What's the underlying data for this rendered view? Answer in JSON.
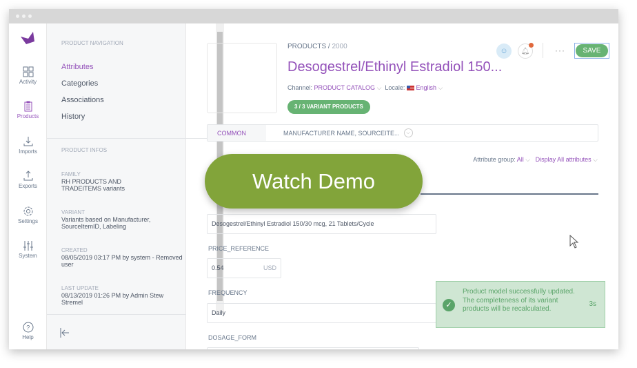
{
  "sidebar": {
    "items": [
      {
        "label": "Activity",
        "icon": "grid-icon"
      },
      {
        "label": "Products",
        "icon": "clipboard-icon",
        "active": true
      },
      {
        "label": "Imports",
        "icon": "import-icon"
      },
      {
        "label": "Exports",
        "icon": "export-icon"
      },
      {
        "label": "Settings",
        "icon": "gear-icon"
      },
      {
        "label": "System",
        "icon": "sliders-icon"
      }
    ],
    "help": "Help"
  },
  "nav": {
    "section_title": "PRODUCT NAVIGATION",
    "links": [
      "Attributes",
      "Categories",
      "Associations",
      "History"
    ],
    "infos_title": "PRODUCT INFOS",
    "infos": [
      {
        "label": "FAMILY",
        "value": "RH PRODUCTS AND TRADEITEMS variants"
      },
      {
        "label": "VARIANT",
        "value": "Variants based on Manufacturer, SourceItemID, Labeling"
      },
      {
        "label": "CREATED",
        "value": "08/05/2019 03:17 PM by system - Removed user"
      },
      {
        "label": "LAST UPDATE",
        "value": "08/13/2019 01:26 PM by Admin Stew Stremel"
      }
    ]
  },
  "header": {
    "breadcrumb": "PRODUCTS",
    "breadcrumb_sep": " / ",
    "product_id": "2000",
    "title": "Desogestrel/Ethinyl Estradiol 150...",
    "channel_label": "Channel: ",
    "channel": "PRODUCT CATALOG",
    "locale_label": "Locale: ",
    "locale": "English",
    "variants_badge": "3 / 3 VARIANT PRODUCTS",
    "more": "···",
    "save": "SAVE"
  },
  "tabs": {
    "common": "COMMON",
    "variant": "MANUFACTURER NAME, SOURCEITE..."
  },
  "filters": {
    "group_label": "Attribute group: ",
    "group": "All",
    "display": "Display All attributes"
  },
  "fields": {
    "name_value": "Desogestrel/Ethinyl Estradiol 150/30 mcg, 21 Tablets/Cycle",
    "price_label": "PRICE_REFERENCE",
    "price_value": "0.54",
    "price_unit": "USD",
    "frequency_label": "FREQUENCY",
    "frequency_value": "Daily",
    "dosage_label": "DOSAGE_FORM"
  },
  "overlay": {
    "watch_demo": "Watch Demo"
  },
  "toast": {
    "message": "Product model successfully updated. The completeness of its variant products will be recalculated.",
    "time": "3s"
  },
  "colors": {
    "accent": "#9452ba",
    "success": "#67b373",
    "demo": "#82a43a"
  }
}
